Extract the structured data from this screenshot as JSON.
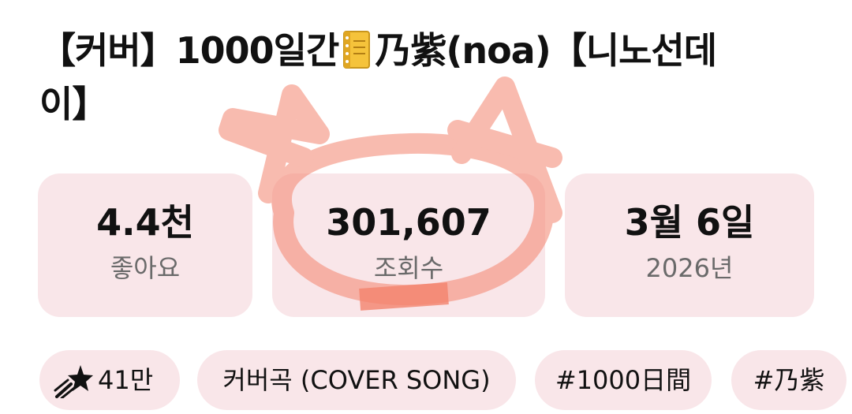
{
  "video": {
    "title_part1": "【커버】1000일간",
    "title_icon": "notebook-icon",
    "title_part2": "乃紫(noa)【니노선데이】"
  },
  "stats": [
    {
      "value": "4.4천",
      "label": "좋아요"
    },
    {
      "value": "301,607",
      "label": "조회수"
    },
    {
      "value": "3월 6일",
      "label": "2026년"
    }
  ],
  "chips": {
    "thanks_icon": "shooting-star-icon",
    "thanks_count": "41만",
    "cover": "커버곡 (COVER SONG)",
    "tag1": "#1000日間",
    "tag2": "#乃紫"
  },
  "colors": {
    "card_background": "#f9e6e9",
    "doodle": "#f4846e"
  }
}
